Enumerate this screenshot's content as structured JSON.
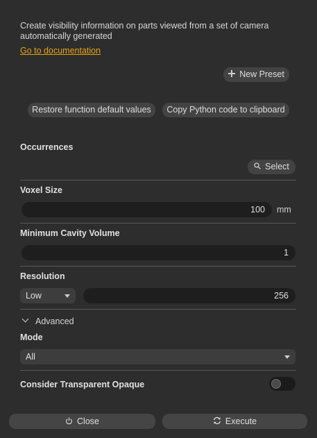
{
  "description": "Create visibility information on parts viewed from a set of camera automatically generated",
  "doc_link": "Go to documentation",
  "presets": {
    "new_preset_label": "New Preset",
    "plus_icon": "plus-icon"
  },
  "actions": {
    "restore_label": "Restore function default values",
    "copy_label": "Copy Python code to clipboard"
  },
  "occurrences": {
    "label": "Occurrences",
    "select_label": "Select",
    "search_icon": "search-icon"
  },
  "voxel_size": {
    "label": "Voxel Size",
    "value": "100",
    "unit": "mm"
  },
  "min_cavity": {
    "label": "Minimum Cavity Volume",
    "value": "1"
  },
  "resolution": {
    "label": "Resolution",
    "preset": "Low",
    "value": "256"
  },
  "advanced": {
    "label": "Advanced",
    "expanded": true
  },
  "mode": {
    "label": "Mode",
    "value": "All"
  },
  "transparent": {
    "label": "Consider Transparent Opaque",
    "enabled": false
  },
  "footer": {
    "close_label": "Close",
    "execute_label": "Execute"
  },
  "colors": {
    "accent_link": "#e8a317",
    "background": "#2d2d2d",
    "field": "#1e1e1e"
  }
}
